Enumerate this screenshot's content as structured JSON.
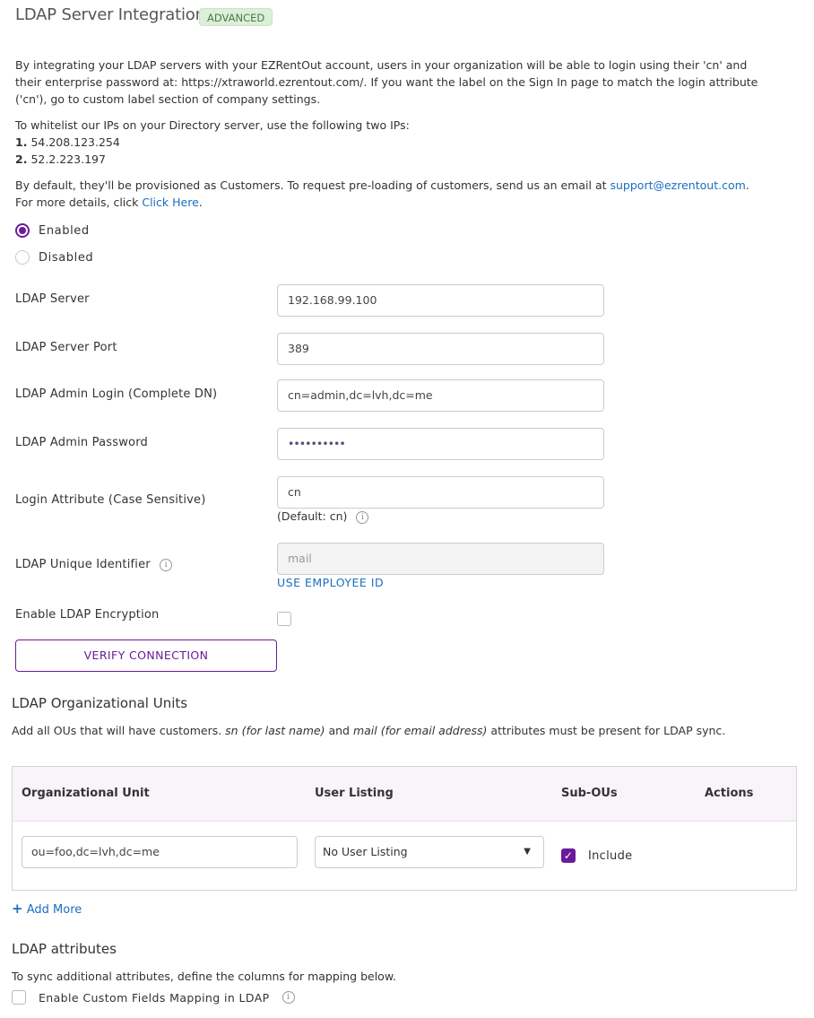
{
  "header": {
    "title": "LDAP Server Integration",
    "badge": "ADVANCED"
  },
  "intro": {
    "line1": "By integrating your LDAP servers with your EZRentOut account, users in your organization will be able to login using their 'cn' and",
    "line2": "their enterprise password at: https://xtraworld.ezrentout.com/. If you want the label on the Sign In page to match the login attribute",
    "line3": "('cn'), go to custom label section of company settings."
  },
  "whitelist": {
    "text": "To whitelist our IPs on your Directory server, use the following two IPs:",
    "ips": [
      {
        "num": "1.",
        "ip": "54.208.123.254"
      },
      {
        "num": "2.",
        "ip": "52.2.223.197"
      }
    ]
  },
  "provision": {
    "text": "By default, they'll be provisioned as Customers. To request pre-loading of customers, send us an email at ",
    "email": "support@ezrentout.com",
    "after_email": ".",
    "more_text": "For more details, click ",
    "more_link": "Click Here",
    "more_after": "."
  },
  "status": {
    "options": [
      {
        "label": "Enabled",
        "selected": true
      },
      {
        "label": "Disabled",
        "selected": false
      }
    ]
  },
  "form": {
    "server_label": "LDAP Server",
    "server_value": "192.168.99.100",
    "port_label": "LDAP Server Port",
    "port_value": "389",
    "admin_login_label": "LDAP Admin Login (Complete DN)",
    "admin_login_value": "cn=admin,dc=lvh,dc=me",
    "admin_password_label": "LDAP Admin Password",
    "admin_password_value": "••••••••••",
    "login_attr_label": "Login Attribute (Case Sensitive)",
    "login_attr_value": "cn",
    "login_attr_hint": "(Default: cn)",
    "unique_id_label": "LDAP Unique Identifier",
    "unique_id_value": "mail",
    "use_employee_id": "USE EMPLOYEE ID",
    "encryption_label": "Enable LDAP Encryption",
    "encryption_checked": false,
    "verify_button": "VERIFY CONNECTION"
  },
  "ou_section": {
    "title": "LDAP Organizational Units",
    "desc_pre": "Add all OUs that will have customers. ",
    "desc_em1": "sn (for last name)",
    "desc_mid": " and ",
    "desc_em2": "mail (for email address)",
    "desc_post": " attributes must be present for LDAP sync.",
    "columns": [
      "Organizational Unit",
      "User Listing",
      "Sub-OUs",
      "Actions"
    ],
    "rows": [
      {
        "ou": "ou=foo,dc=lvh,dc=me",
        "user_listing": "No User Listing",
        "sub_ous_checked": true,
        "sub_ous_label": "Include"
      }
    ],
    "add_more": "Add More"
  },
  "attributes_section": {
    "title": "LDAP attributes",
    "desc": "To sync additional attributes, define the columns for mapping below.",
    "custom_fields_label": "Enable Custom Fields Mapping in LDAP",
    "custom_fields_checked": false
  },
  "colors": {
    "accent": "#6a1b9a",
    "link": "#1a6fc0",
    "badge_bg": "#dcefd9"
  }
}
